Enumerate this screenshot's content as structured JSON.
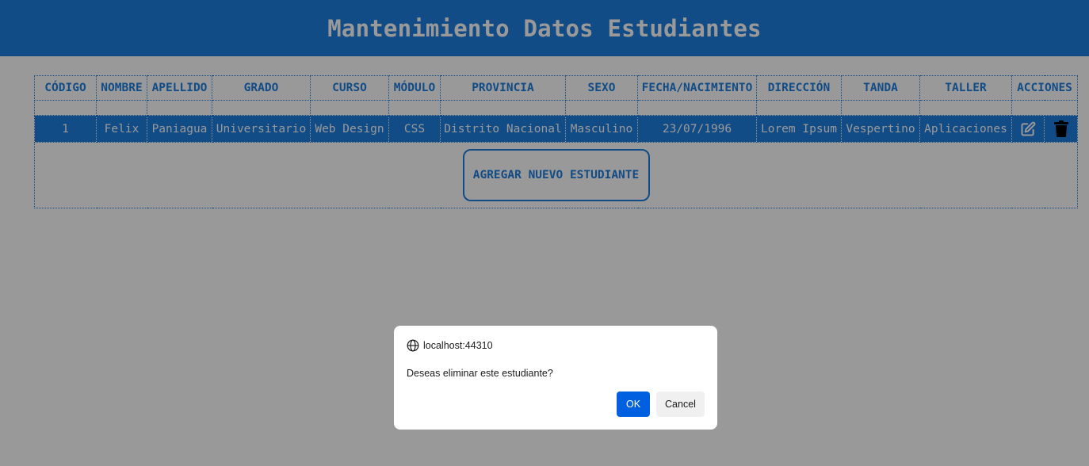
{
  "header": {
    "title": "Mantenimiento Datos Estudiantes"
  },
  "table": {
    "columns": [
      "CÓDIGO",
      "NOMBRE",
      "APELLIDO",
      "GRADO",
      "CURSO",
      "MÓDULO",
      "PROVINCIA",
      "SEXO",
      "FECHA/NACIMIENTO",
      "DIRECCIÓN",
      "TANDA",
      "TALLER",
      "ACCIONES"
    ],
    "rows": [
      {
        "codigo": "1",
        "nombre": "Felix",
        "apellido": "Paniagua",
        "grado": "Universitario",
        "curso": "Web Design",
        "modulo": "CSS",
        "provincia": "Distrito Nacional",
        "sexo": "Masculino",
        "fecha_nacimiento": "23/07/1996",
        "direccion": "Lorem Ipsum",
        "tanda": "Vespertino",
        "taller": "Aplicaciones",
        "actions": [
          "edit-icon",
          "trash-icon"
        ]
      }
    ],
    "add_button_label": "AGREGAR NUEVO ESTUDIANTE"
  },
  "dialog": {
    "origin": "localhost:44310",
    "origin_icon": "globe-icon",
    "message": "Deseas eliminar este estudiante?",
    "ok_label": "OK",
    "cancel_label": "Cancel"
  },
  "colors": {
    "primary": "#1f7fe0",
    "dialog_ok": "#0060df",
    "overlay": "rgba(0,0,0,0.40)"
  }
}
